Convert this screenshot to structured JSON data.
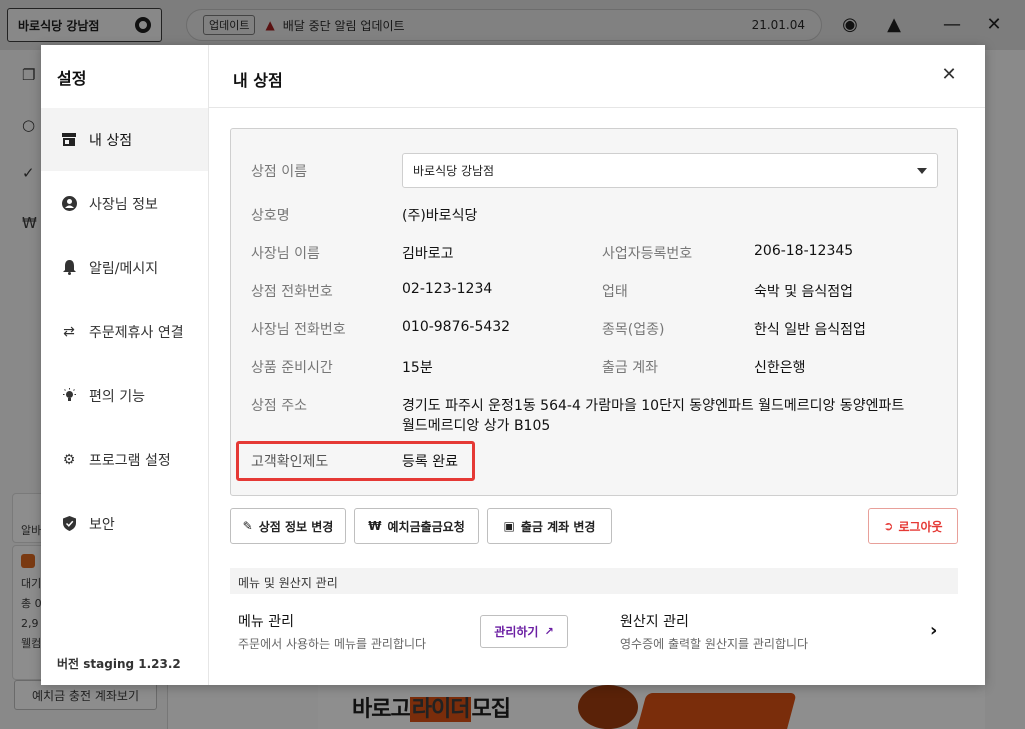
{
  "background": {
    "store_chip": "바로식당 강남점",
    "notice": {
      "tag": "업데이트",
      "text": "배달 중단 알림 업데이트",
      "date": "21.01.04"
    },
    "card_small_text": "알바",
    "card2_lines": [
      "대기",
      "총 0",
      "2,9",
      "웰컴"
    ],
    "deposit_button": "예치금 충전 계좌보기",
    "banner": {
      "text_a": "바로고",
      "text_b": "라이더",
      "text_c": "모집"
    }
  },
  "settings": {
    "title": "설정",
    "menu": [
      {
        "label": "내 상점",
        "icon": "store-icon",
        "active": true
      },
      {
        "label": "사장님 정보",
        "icon": "user-icon",
        "active": false
      },
      {
        "label": "알림/메시지",
        "icon": "bell-icon",
        "active": false
      },
      {
        "label": "주문제휴사 연결",
        "icon": "swap-icon",
        "active": false
      },
      {
        "label": "편의 기능",
        "icon": "bulb-icon",
        "active": false
      },
      {
        "label": "프로그램 설정",
        "icon": "gear-icon",
        "active": false
      },
      {
        "label": "보안",
        "icon": "shield-icon",
        "active": false
      }
    ],
    "version": "버전 staging 1.23.2"
  },
  "my_store": {
    "title": "내 상점",
    "fields": {
      "store_name_label": "상점 이름",
      "store_name_value": "바로식당 강남점",
      "company_label": "상호명",
      "company_value": "(주)바로식당",
      "owner_label": "사장님 이름",
      "owner_value": "김바로고",
      "biz_no_label": "사업자등록번호",
      "biz_no_value": "206-18-12345",
      "store_phone_label": "상점 전화번호",
      "store_phone_value": "02-123-1234",
      "biz_type_label": "업태",
      "biz_type_value": "숙박 및 음식점업",
      "owner_phone_label": "사장님 전화번호",
      "owner_phone_value": "010-9876-5432",
      "biz_item_label": "종목(업종)",
      "biz_item_value": "한식 일반 음식점업",
      "prep_time_label": "상품 준비시간",
      "prep_time_value": "15분",
      "payout_label": "출금 계좌",
      "payout_value": "신한은행",
      "address_label": "상점 주소",
      "address_line1": "경기도 파주시 운정1동 564-4 가람마을 10단지 동양엔파트 월드메르디앙 동양엔파트",
      "address_line2": "월드메르디앙 상가 B105",
      "verify_label": "고객확인제도",
      "verify_value": "등록 완료"
    },
    "buttons": {
      "edit_store": "상점 정보 변경",
      "deposit_withdraw": "예치금출금요청",
      "change_account": "출금 계좌 변경",
      "logout": "로그아웃"
    },
    "menu_section": {
      "header": "메뉴 및 원산지 관리",
      "menu_title": "메뉴 관리",
      "menu_desc": "주문에서 사용하는 메뉴를 관리합니다",
      "manage_button": "관리하기",
      "origin_title": "원산지 관리",
      "origin_desc": "영수증에 출력할 원산지를 관리합니다"
    }
  },
  "colors": {
    "highlight": "#e53935",
    "logout": "#e53935",
    "manage": "#6b1fa3"
  }
}
